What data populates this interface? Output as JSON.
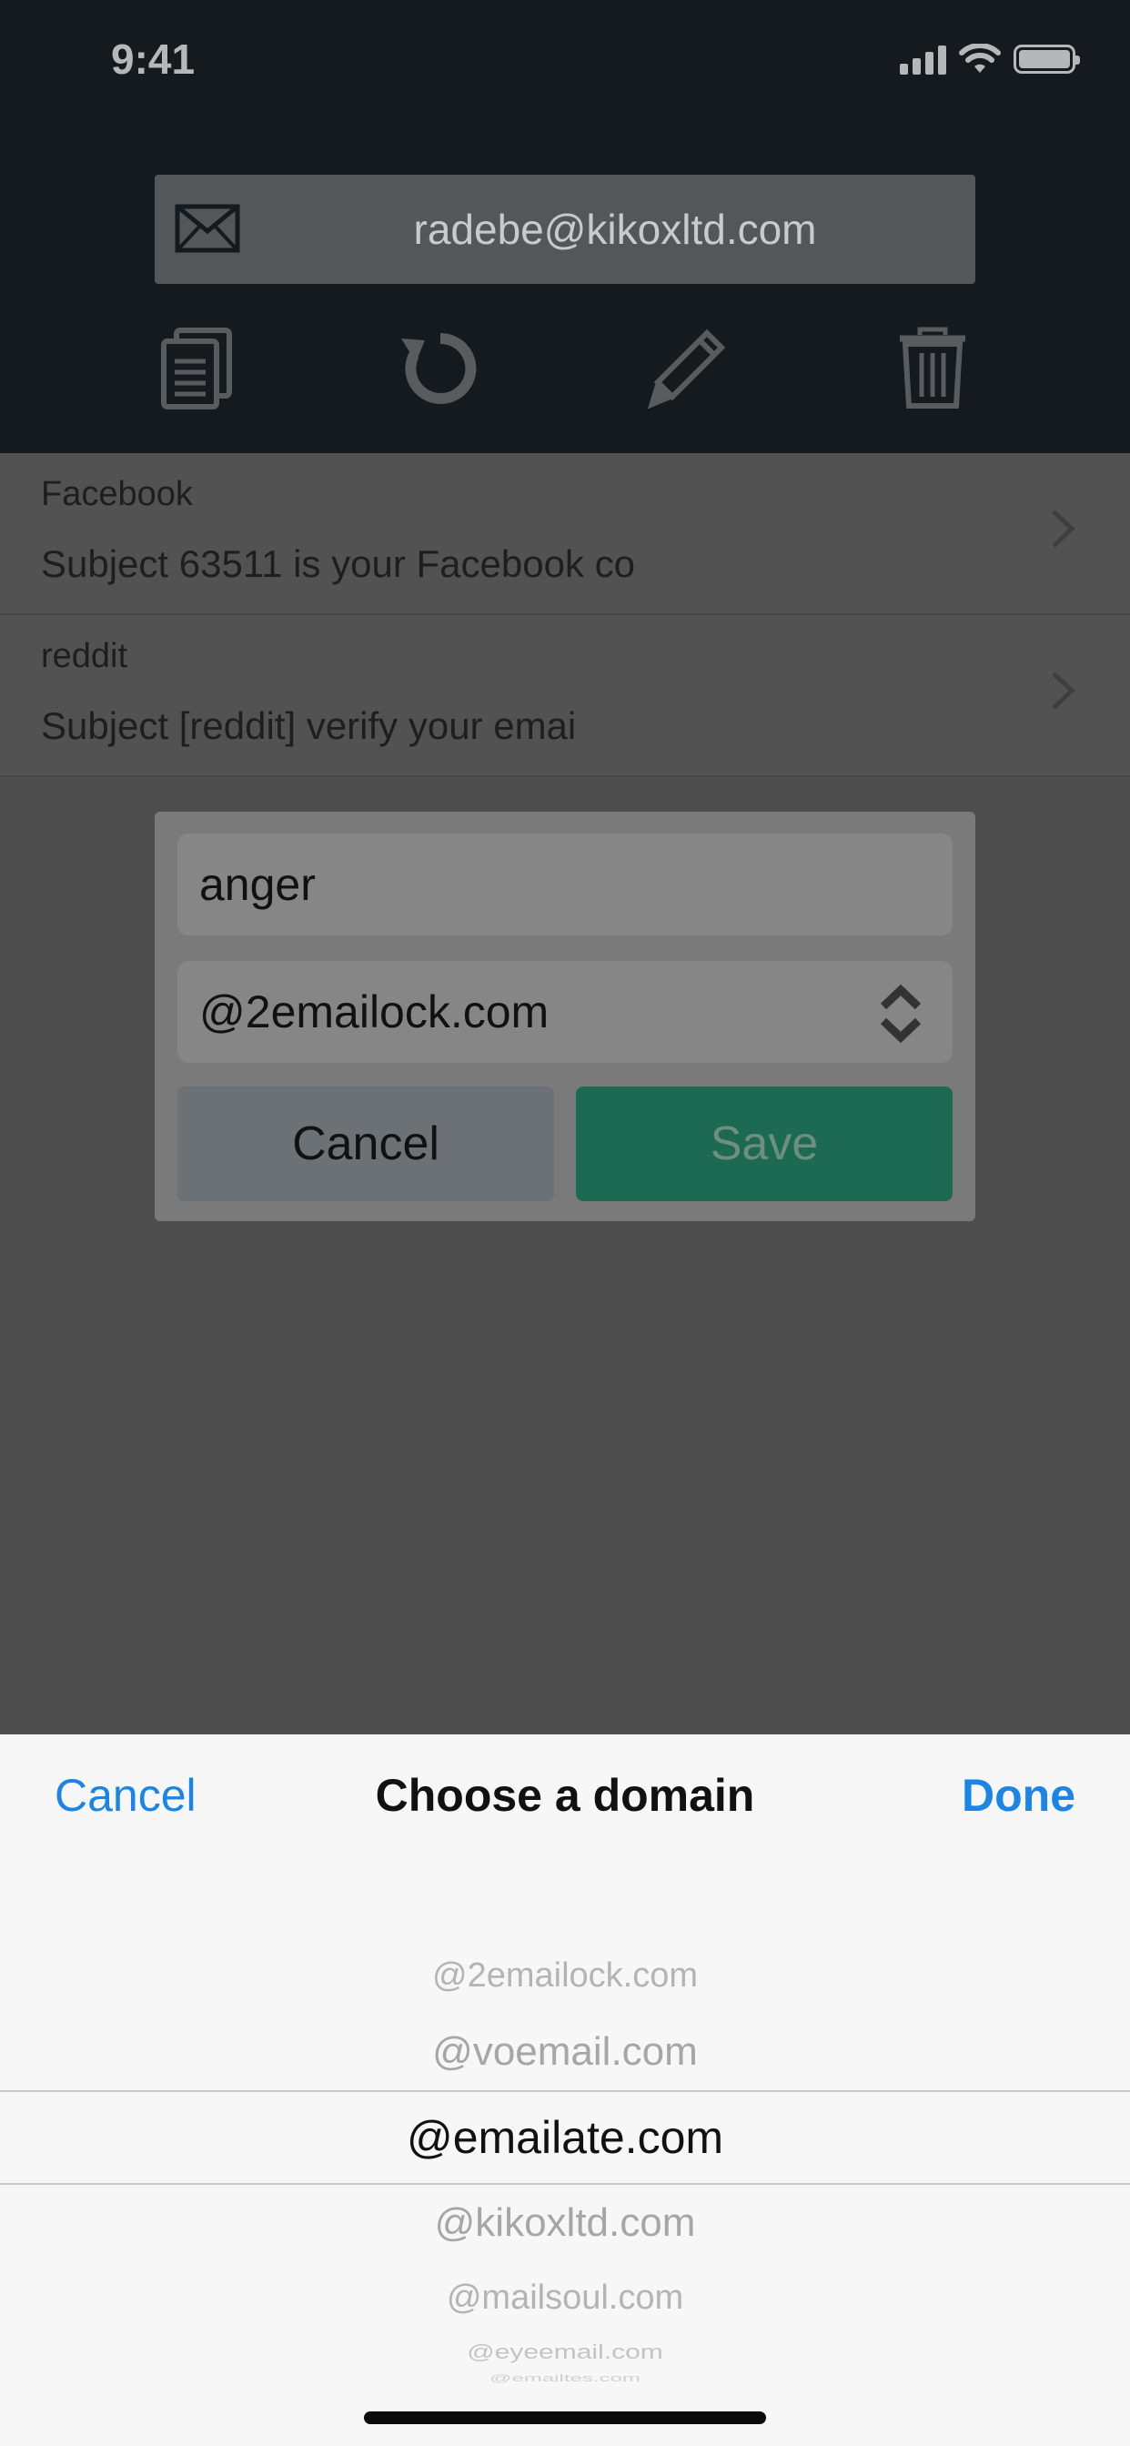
{
  "status_bar": {
    "time": "9:41"
  },
  "header": {
    "email": "radebe@kikoxltd.com"
  },
  "toolbar": {
    "icons": [
      "copy-icon",
      "refresh-icon",
      "edit-icon",
      "trash-icon"
    ]
  },
  "messages": [
    {
      "sender": "Facebook",
      "subject": "Subject 63511 is your Facebook co"
    },
    {
      "sender": "reddit",
      "subject": "Subject [reddit] verify your emai"
    }
  ],
  "dialog": {
    "name_value": "anger",
    "domain_value": "@2emailock.com",
    "cancel_label": "Cancel",
    "save_label": "Save"
  },
  "picker": {
    "cancel_label": "Cancel",
    "title": "Choose a domain",
    "done_label": "Done",
    "options": [
      "@2emailock.com",
      "@voemail.com",
      "@emailate.com",
      "@kikoxltd.com",
      "@mailsoul.com",
      "@eyeemail.com",
      "@emailtes.com"
    ],
    "selected": "@emailate.com"
  },
  "colors": {
    "accent": "#1b84e7",
    "save_green": "#1d6a52",
    "header_bg": "#151a1f"
  }
}
